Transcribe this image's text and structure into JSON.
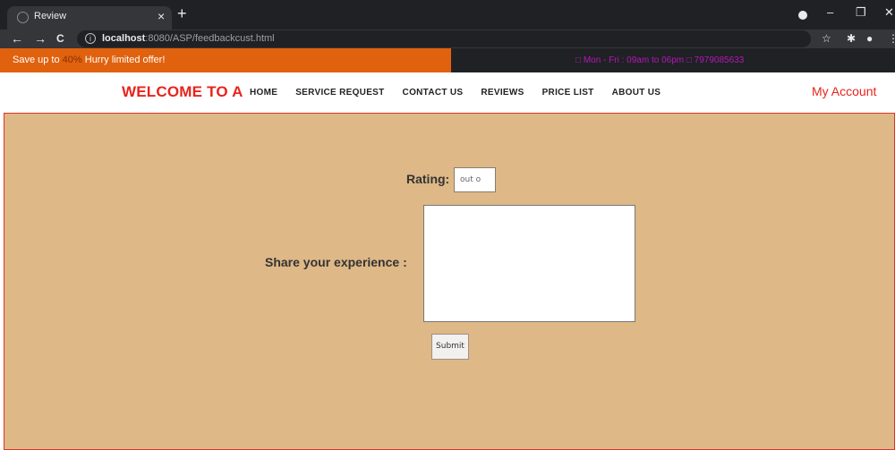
{
  "browser": {
    "tab_title": "Review",
    "tab_close": "×",
    "new_tab": "+",
    "url_host": "localhost",
    "url_rest": ":8080/ASP/feedbackcust.html",
    "back": "←",
    "forward": "→",
    "reload": "C",
    "star": "☆",
    "minimize": "–",
    "maximize": "❐",
    "close": "✕"
  },
  "promo": {
    "prefix": "Save up to ",
    "highlight": "40%",
    "suffix": " Hurry limited offer!",
    "hours": "□  Mon - Fri : 09am to 06pm   □  7979085633"
  },
  "site": {
    "brand": "WELCOME TO A",
    "nav": [
      "HOME",
      "SERVICE REQUEST",
      "CONTACT US",
      "REVIEWS",
      "PRICE LIST",
      "ABOUT US"
    ],
    "account": "My Account"
  },
  "form": {
    "rating_label": "Rating:",
    "rating_placeholder": "out o",
    "experience_label": "Share your experience :",
    "submit_label": "Submit"
  },
  "colors": {
    "promo_orange": "#e0620f",
    "brand_red": "#e8231c",
    "form_bg": "#deb887"
  }
}
